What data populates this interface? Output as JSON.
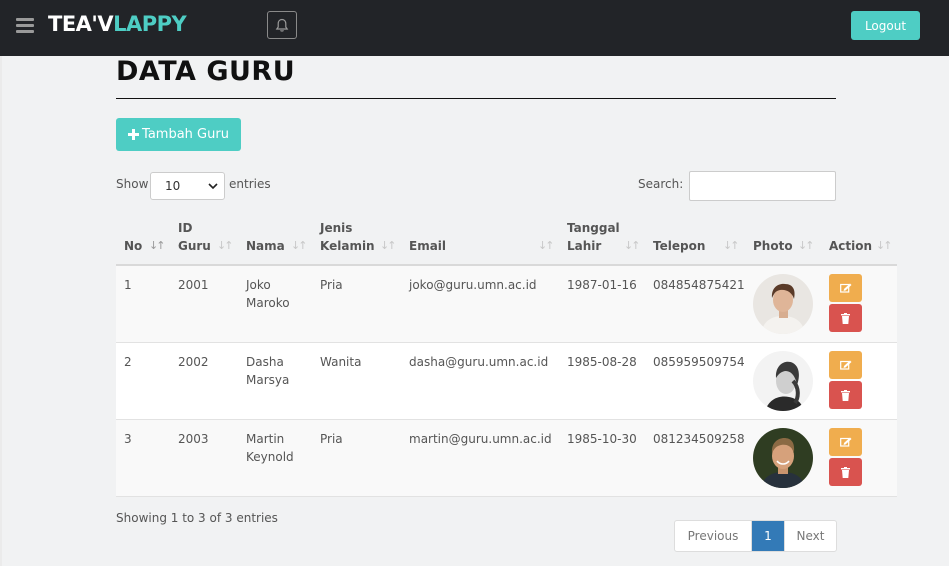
{
  "app": {
    "brand_part1": "TEA'V",
    "brand_part2": "LAPPY",
    "logout_label": "Logout"
  },
  "page": {
    "title": "DATA GURU",
    "add_button_label": "Tambah Guru"
  },
  "controls": {
    "show_label": "Show",
    "page_length": "10",
    "entries_label": "entries",
    "search_label": "Search:",
    "search_value": ""
  },
  "table": {
    "columns": {
      "no": "No",
      "id_line1": "ID",
      "id_line2": "Guru",
      "nama": "Nama",
      "jk_line1": "Jenis",
      "jk_line2": "Kelamin",
      "email": "Email",
      "tgl_line1": "Tanggal",
      "tgl_line2": "Lahir",
      "telepon": "Telepon",
      "photo": "Photo",
      "action": "Action"
    },
    "rows": [
      {
        "no": "1",
        "id": "2001",
        "nama_line1": "Joko",
        "nama_line2": "Maroko",
        "jenis_kelamin": "Pria",
        "email": "joko@guru.umn.ac.id",
        "tanggal_lahir": "1987-01-16",
        "telepon": "084854875421"
      },
      {
        "no": "2",
        "id": "2002",
        "nama_line1": "Dasha",
        "nama_line2": "Marsya",
        "jenis_kelamin": "Wanita",
        "email": "dasha@guru.umn.ac.id",
        "tanggal_lahir": "1985-08-28",
        "telepon": "085959509754"
      },
      {
        "no": "3",
        "id": "2003",
        "nama_line1": "Martin",
        "nama_line2": "Keynold",
        "jenis_kelamin": "Pria",
        "email": "martin@guru.umn.ac.id",
        "tanggal_lahir": "1985-10-30",
        "telepon": "081234509258"
      }
    ]
  },
  "footer": {
    "info": "Showing 1 to 3 of 3 entries",
    "prev_label": "Previous",
    "current_page": "1",
    "next_label": "Next"
  },
  "colors": {
    "accent": "#4ecdc4",
    "topbar": "#222428",
    "edit": "#f0ad4e",
    "delete": "#d9534f",
    "pager_active": "#337ab7"
  },
  "icons": [
    "menu-icon",
    "bell-icon",
    "plus-icon",
    "sort-icon",
    "edit-icon",
    "trash-icon"
  ]
}
